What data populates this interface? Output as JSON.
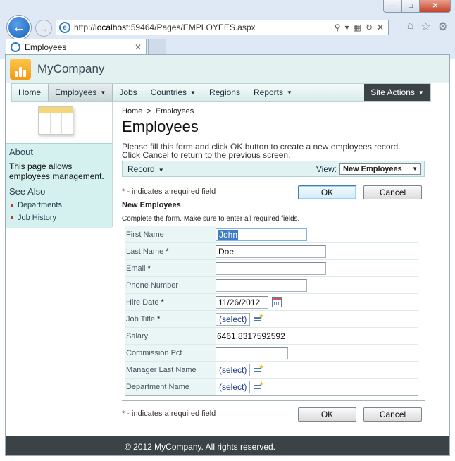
{
  "browser": {
    "url_prefix": "http://",
    "url_host": "localhost",
    "url_rest": ":59464/Pages/EMPLOYEES.aspx",
    "tab_title": "Employees"
  },
  "header": {
    "brand": "MyCompany"
  },
  "nav": {
    "items": [
      {
        "label": "Home",
        "has_menu": false,
        "active": false
      },
      {
        "label": "Employees",
        "has_menu": true,
        "active": true
      },
      {
        "label": "Jobs",
        "has_menu": false,
        "active": false
      },
      {
        "label": "Countries",
        "has_menu": true,
        "active": false
      },
      {
        "label": "Regions",
        "has_menu": false,
        "active": false
      },
      {
        "label": "Reports",
        "has_menu": true,
        "active": false
      }
    ],
    "site_actions": "Site Actions"
  },
  "sidebar": {
    "about_title": "About",
    "about_text": "This page allows employees management.",
    "see_also_title": "See Also",
    "links": [
      "Departments",
      "Job History"
    ]
  },
  "main": {
    "breadcrumb_home": "Home",
    "breadcrumb_sep": ">",
    "breadcrumb_current": "Employees",
    "title": "Employees",
    "desc_line1": "Please fill this form and click OK button to create a new employees record.",
    "desc_line2": "Click Cancel to return to the previous screen."
  },
  "viewbar": {
    "record_label": "Record",
    "view_label": "View:",
    "view_value": "New Employees"
  },
  "form": {
    "required_note": "* - indicates a required field",
    "ok_label": "OK",
    "cancel_label": "Cancel",
    "category": "New Employees",
    "hint": "Complete the form. Make sure to enter all required fields.",
    "fields": {
      "first_name": {
        "label": "First Name",
        "value": "John"
      },
      "last_name": {
        "label": "Last Name",
        "value": "Doe",
        "required": "*"
      },
      "email": {
        "label": "Email",
        "value": "",
        "required": "*"
      },
      "phone": {
        "label": "Phone Number",
        "value": ""
      },
      "hire_date": {
        "label": "Hire Date",
        "value": "11/26/2012",
        "required": "*"
      },
      "job_title": {
        "label": "Job Title",
        "value": "(select)",
        "required": "*"
      },
      "salary": {
        "label": "Salary",
        "value": "6461.8317592592"
      },
      "commission": {
        "label": "Commission Pct",
        "value": ""
      },
      "manager": {
        "label": "Manager Last Name",
        "value": "(select)"
      },
      "department": {
        "label": "Department Name",
        "value": "(select)"
      }
    }
  },
  "footer": {
    "text": "© 2012 MyCompany. All rights reserved."
  }
}
